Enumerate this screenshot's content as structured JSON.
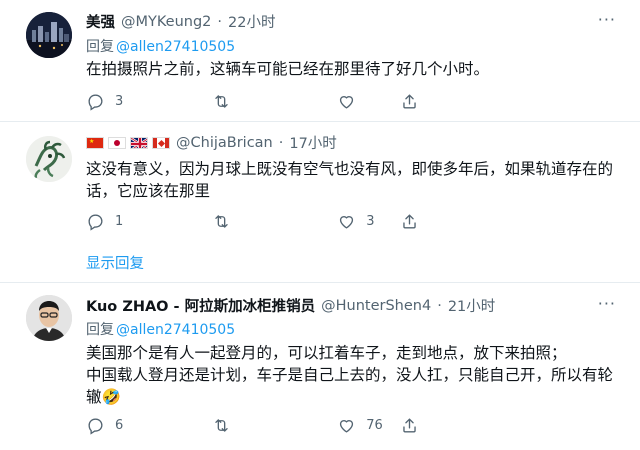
{
  "tweets": [
    {
      "name": "美强",
      "handle": "@MYKeung2",
      "separator": "·",
      "time": "22小时",
      "reply_prefix": "回复",
      "reply_to": "@allen27410505",
      "body": "在拍摄照片之前，这辆车可能已经在那里待了好几个小时。",
      "reply_count": "3",
      "retweet_count": "",
      "like_count": "",
      "more": "···"
    },
    {
      "name_icons": [
        "china-flag-icon",
        "japan-flag-icon",
        "uk-flag-icon",
        "canada-flag-icon"
      ],
      "handle": "@ChijaBrican",
      "separator": "·",
      "time": "17小时",
      "body": "这没有意义，因为月球上既没有空气也没有风，即使多年后，如果轨道存在的话，它应该在那里",
      "reply_count": "1",
      "retweet_count": "",
      "like_count": "3",
      "show_replies": "显示回复"
    },
    {
      "name": "Kuo ZHAO - 阿拉斯加冰柜推销员",
      "handle": "@HunterShen4",
      "separator": "·",
      "time": "21小时",
      "reply_prefix": "回复",
      "reply_to": "@allen27410505",
      "body": "美国那个是有人一起登月的，可以扛着车子，走到地点，放下来拍照；\n中国载人登月还是计划，车子是自己上去的，没人扛，只能自己开，所以有轮辙🤣",
      "reply_count": "6",
      "retweet_count": "",
      "like_count": "76",
      "more": "···"
    }
  ],
  "colors": {
    "link": "#1d9bf0",
    "muted": "#536471",
    "text": "#0f1419",
    "divider": "#e6ecf0"
  }
}
